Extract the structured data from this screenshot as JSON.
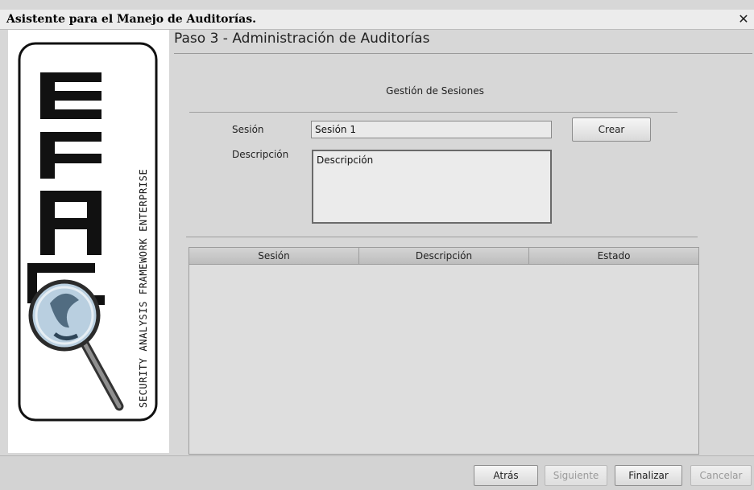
{
  "window": {
    "title": "Asistente para el Manejo de Auditorías.",
    "close_icon": "close-icon"
  },
  "logo": {
    "image_description": "SAFE - Security Analysis Framework Enterprise logo with magnifying glass"
  },
  "step": {
    "title": "Paso 3 - Administración de Auditorías"
  },
  "section": {
    "title": "Gestión de Sesiones"
  },
  "form": {
    "session_label": "Sesión",
    "session_value": "Sesión 1",
    "description_label": "Descripción",
    "description_value": "Descripción",
    "create_button": "Crear"
  },
  "table": {
    "columns": [
      "Sesión",
      "Descripción",
      "Estado"
    ],
    "rows": []
  },
  "footer": {
    "back_button": "Atrás",
    "next_button": "Siguiente",
    "finish_button": "Finalizar",
    "cancel_button": "Cancelar"
  }
}
